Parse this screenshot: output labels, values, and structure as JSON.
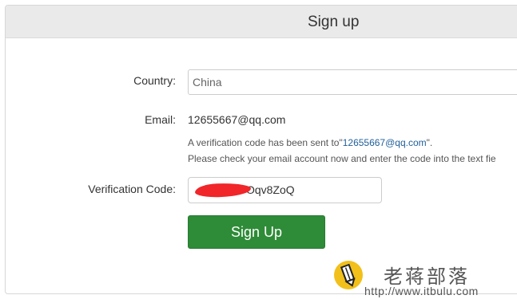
{
  "panel": {
    "title": "Sign up"
  },
  "form": {
    "country_label": "Country:",
    "country_value": "China",
    "email_label": "Email:",
    "email_value": "12655667@qq.com",
    "verify_note_prefix": "A verification code has been sent to\"",
    "verify_note_email": "12655667@qq.com",
    "verify_note_suffix": "\".",
    "verify_note_line2": "Please check your email account now and enter the code into the text fie",
    "code_label": "Verification Code:",
    "code_value": "Oqv8ZoQ",
    "submit_label": "Sign Up"
  },
  "watermark": {
    "title": "老蒋部落",
    "url": "http://www.itbulu.com"
  },
  "colors": {
    "header_bg": "#eaeaea",
    "button_green": "#2e8b37",
    "link_blue": "#1f5e9a",
    "redaction_red": "#f0262a",
    "logo_yellow": "#f2c01a"
  }
}
